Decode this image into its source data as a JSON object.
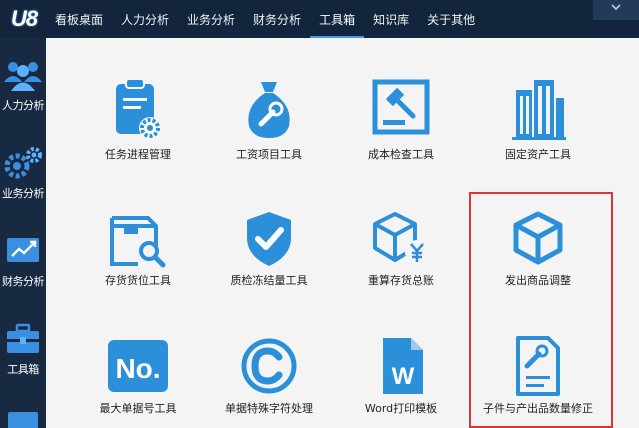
{
  "app": {
    "logo_text": "U8"
  },
  "nav": {
    "tabs": [
      {
        "label": "看板桌面"
      },
      {
        "label": "人力分析"
      },
      {
        "label": "业务分析"
      },
      {
        "label": "财务分析"
      },
      {
        "label": "工具箱",
        "active": true
      },
      {
        "label": "知识库"
      },
      {
        "label": "关于其他"
      }
    ],
    "dropdown_icon": "chevron-down-icon"
  },
  "sidebar": {
    "items": [
      {
        "label": "人力分析",
        "icon": "people-icon"
      },
      {
        "label": "业务分析",
        "icon": "gears-icon"
      },
      {
        "label": "财务分析",
        "icon": "trend-chart-icon"
      },
      {
        "label": "工具箱",
        "icon": "toolbox-icon"
      }
    ]
  },
  "tools": [
    {
      "label": "任务进程管理",
      "icon": "clipboard-gear-icon"
    },
    {
      "label": "工资项目工具",
      "icon": "money-bag-wrench-icon"
    },
    {
      "label": "成本检查工具",
      "icon": "gavel-icon"
    },
    {
      "label": "固定资产工具",
      "icon": "building-icon"
    },
    {
      "label": "存货货位工具",
      "icon": "box-search-icon"
    },
    {
      "label": "质检冻结量工具",
      "icon": "shield-check-icon"
    },
    {
      "label": "重算存货总账",
      "icon": "box-yen-icon"
    },
    {
      "label": "发出商品调整",
      "icon": "cube-icon"
    },
    {
      "label": "最大单据号工具",
      "icon": "no-badge-icon",
      "badge_text": "No."
    },
    {
      "label": "单据特殊字符处理",
      "icon": "copyright-icon"
    },
    {
      "label": "Word打印模板",
      "icon": "word-file-icon",
      "badge_text": "W"
    },
    {
      "label": "子件与产出品数量修正",
      "icon": "document-wrench-icon"
    }
  ],
  "colors": {
    "accent": "#2b8fd9",
    "topbar": "#12253d",
    "sidebar": "#172a42",
    "highlight": "#e03434"
  }
}
